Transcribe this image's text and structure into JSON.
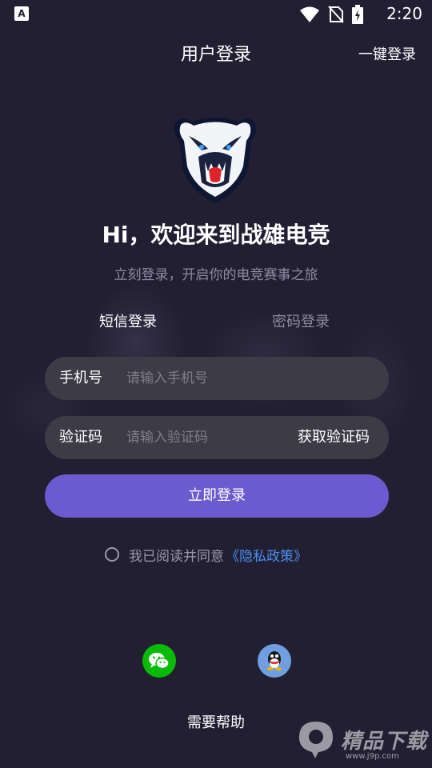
{
  "status_bar": {
    "app_icon_letter": "A",
    "time": "2:20",
    "icons": [
      "wifi-icon",
      "no-sim-icon",
      "battery-charging-icon"
    ]
  },
  "header": {
    "title": "用户登录",
    "onekey_login": "一键登录"
  },
  "welcome": {
    "title": "Hi，欢迎来到战雄电竞",
    "subtitle": "立刻登录，开启你的电竞赛事之旅"
  },
  "tabs": [
    {
      "label": "短信登录",
      "active": true
    },
    {
      "label": "密码登录",
      "active": false
    }
  ],
  "form": {
    "phone_label": "手机号",
    "phone_placeholder": "请输入手机号",
    "code_label": "验证码",
    "code_placeholder": "请输入验证码",
    "get_code": "获取验证码",
    "submit": "立即登录"
  },
  "agreement": {
    "text": "我已阅读并同意",
    "policy": "《隐私政策》",
    "checked": false
  },
  "social": [
    "wechat-icon",
    "qq-icon"
  ],
  "help": "需要帮助",
  "colors": {
    "background": "#221f33",
    "accent": "#6c5bd0",
    "link": "#4a8ef0",
    "field_bg": "#3d3b46"
  }
}
